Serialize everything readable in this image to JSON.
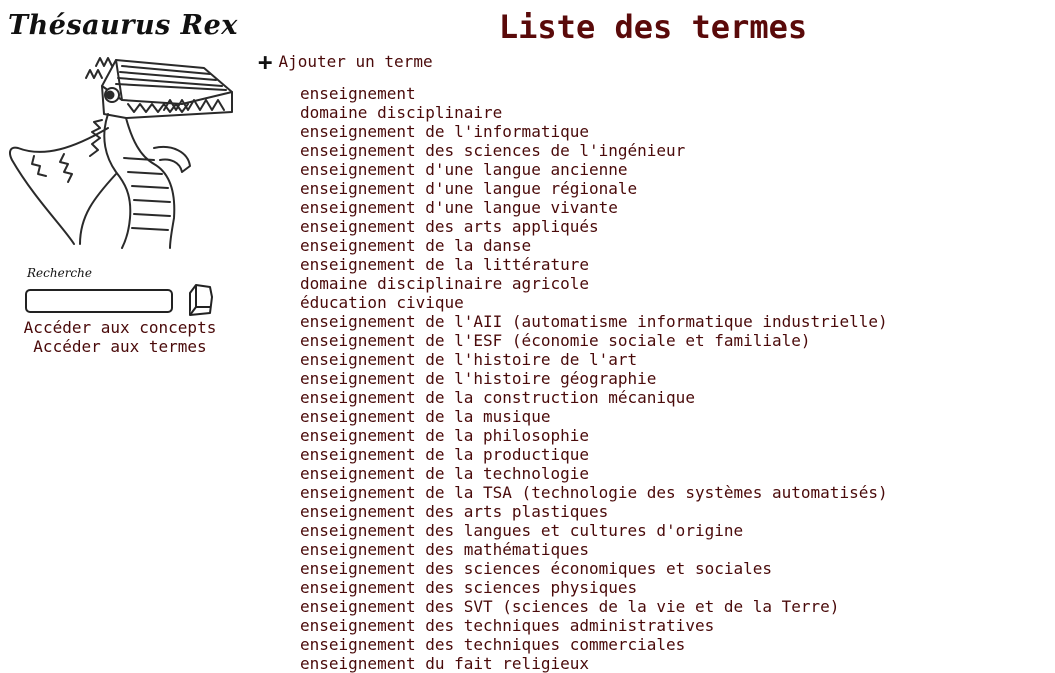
{
  "sidebar": {
    "logo_title": "Thésaurus Rex",
    "search_label": "Recherche",
    "search_value": "",
    "links": {
      "concepts": "Accéder aux concepts",
      "terms": "Accéder aux termes"
    }
  },
  "main": {
    "title": "Liste des termes",
    "add_term_label": "Ajouter un terme",
    "terms": [
      "enseignement",
      "domaine disciplinaire",
      "enseignement de l'informatique",
      "enseignement des sciences de l'ingénieur",
      "enseignement d'une langue ancienne",
      "enseignement d'une langue régionale",
      "enseignement d'une langue vivante",
      "enseignement des arts appliqués",
      "enseignement de la danse",
      "enseignement de la littérature",
      "domaine disciplinaire agricole",
      "éducation civique",
      "enseignement de l'AII (automatisme informatique industrielle)",
      "enseignement de l'ESF (économie sociale et familiale)",
      "enseignement de l'histoire de l'art",
      "enseignement de l'histoire géographie",
      "enseignement de la construction mécanique",
      "enseignement de la musique",
      "enseignement de la philosophie",
      "enseignement de la productique",
      "enseignement de la technologie",
      "enseignement de la TSA (technologie des systèmes automatisés)",
      "enseignement des arts plastiques",
      "enseignement des langues et cultures d'origine",
      "enseignement des mathématiques",
      "enseignement des sciences économiques et sociales",
      "enseignement des sciences physiques",
      "enseignement des SVT (sciences de la vie et de la Terre)",
      "enseignement des techniques administratives",
      "enseignement des techniques commerciales",
      "enseignement du fait religieux"
    ]
  },
  "icons": {
    "mascot": "t-rex-book-head-illustration",
    "add": "plus-icon",
    "search": "search-button-icon"
  },
  "colors": {
    "text": "#4a0a0a",
    "title": "#5a0a0a",
    "background": "#ffffff"
  }
}
